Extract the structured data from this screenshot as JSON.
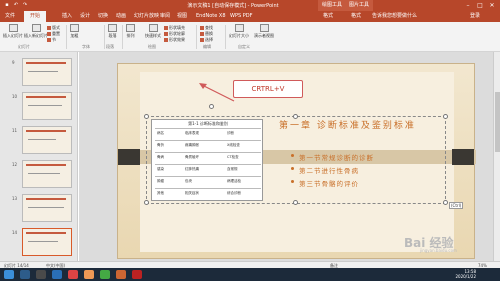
{
  "window": {
    "title": "演示文稿1 [自动保存模式] - PowerPoint",
    "context_tabs": [
      "绘图工具",
      "图片工具"
    ]
  },
  "tabs": [
    "文件",
    "开始",
    "插入",
    "设计",
    "切换",
    "动画",
    "幻灯片放映",
    "审阅",
    "视图",
    "EndNote X8",
    "WPS PDF",
    "格式",
    "格式"
  ],
  "active_tab": "开始",
  "tellme": "告诉我您想要做什么",
  "signin": "登录",
  "ribbon": {
    "paste": "插入幻灯片",
    "new_slide": "插入新幻灯片",
    "layout": "版式",
    "reset": "重置",
    "section": "节",
    "font_bold": "加粗",
    "paragraph": "段落",
    "arrange": "排列",
    "quick_styles": "快速样式",
    "shape_fill": "形状填充",
    "shape_outline": "形状轮廓",
    "shape_effect": "形状效果",
    "find": "查找",
    "replace": "替换",
    "select": "选择",
    "slide_size": "幻灯片大小",
    "dialog": "演示者视图",
    "groups": [
      "幻灯片",
      "字体",
      "段落",
      "绘图",
      "编辑",
      "自定义"
    ]
  },
  "slide_numbers": [
    "9",
    "10",
    "11",
    "12",
    "13",
    "14"
  ],
  "slide": {
    "chapter": "第一章 诊断标准及鉴别标准",
    "bullets": [
      "第一节常规诊断的诊断",
      "第二节进行性骨病",
      "第三节骨骼的评价"
    ],
    "table_title": "第1-1 诊断标准和鉴别",
    "table_rows": [
      [
        "病名",
        "临床表现",
        "诊断"
      ],
      [
        "骨折",
        "疼痛肿胀",
        "X线检查"
      ],
      [
        "骨病",
        "骨质破坏",
        "CT检查"
      ],
      [
        "感染",
        "红肿热痛",
        "血常规"
      ],
      [
        "肿瘤",
        "包块",
        "病理活检"
      ],
      [
        "其他",
        "相关症状",
        "综合诊断"
      ]
    ]
  },
  "callout": "CRTRL+V",
  "smart_tag": "(Ctrl)",
  "status": {
    "slide": "幻灯片 14/14",
    "lang": "中文(中国)",
    "notes": "备注",
    "zoom": "74%"
  },
  "tray": {
    "time": "13:58",
    "date": "2020/1/22"
  },
  "watermark": "Bai 经验",
  "watermark_sub": "jingyan.baidu.com",
  "colors": {
    "accent": "#b7472a",
    "title_text": "#c9702a",
    "callout_border": "#d05a5a"
  }
}
